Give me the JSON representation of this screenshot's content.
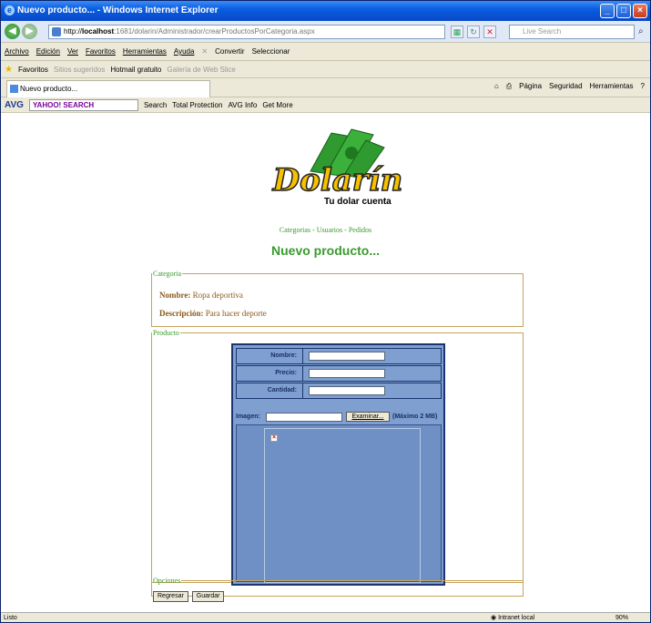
{
  "window": {
    "title": "Nuevo producto... - Windows Internet Explorer"
  },
  "address": {
    "scheme": "http://",
    "host": "localhost",
    "path": ":1681/dolarin/Administrador/crearProductosPorCategoria.aspx"
  },
  "livesearch": {
    "placeholder": "Live Search"
  },
  "menu": {
    "items": [
      "Archivo",
      "Edición",
      "Ver",
      "Favoritos",
      "Herramientas",
      "Ayuda"
    ],
    "convert": "Convertir",
    "select": "Seleccionar"
  },
  "favorites": {
    "label": "Favoritos",
    "suggested": "Sitios sugeridos",
    "hotmail": "Hotmail gratuito",
    "gallery": "Galería de Web Slice"
  },
  "tab": {
    "title": "Nuevo producto..."
  },
  "commandbar": {
    "page": "Página",
    "security": "Seguridad",
    "tools": "Herramientas"
  },
  "avgbar": {
    "avg": "AVG",
    "yahoo_brand": "YAHOO! SEARCH",
    "search": "Search",
    "protection": "Total Protection",
    "info": "AVG Info",
    "getmore": "Get More"
  },
  "logo": {
    "brand": "Dolarín",
    "tagline": "Tu dolar cuenta"
  },
  "nav": {
    "categorias": "Categorias",
    "usuarios": "Usuarios",
    "pedidos": "Pedidos"
  },
  "page": {
    "title": "Nuevo producto..."
  },
  "categoria": {
    "legend": "Categoria",
    "nombre_label": "Nombre:",
    "nombre": "Ropa deportiva",
    "descripcion_label": "Descripción:",
    "descripcion": "Para hacer deporte"
  },
  "producto": {
    "legend": "Producto",
    "nombre_label": "Nombre:",
    "precio_label": "Precio:",
    "cantidad_label": "Cantidad:",
    "imagen_label": "Imagen:",
    "browse": "Examinar...",
    "max": "(Máximo 2 MB)"
  },
  "opciones": {
    "legend": "Opciones",
    "back": "Regresar",
    "save": "Guardar"
  },
  "status": {
    "left": "Listo",
    "zone": "Intranet local",
    "zoom": "90%"
  },
  "colors": {
    "accent_green": "#3a9a2e",
    "panel_blue": "#7e9fd0",
    "fieldset_border": "#c7a35a"
  }
}
